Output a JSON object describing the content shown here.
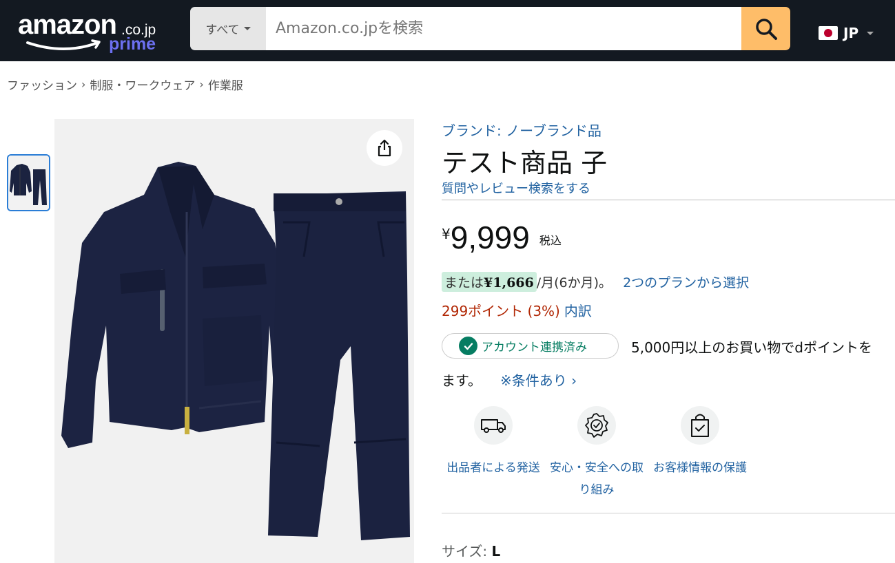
{
  "header": {
    "logo": {
      "word": "amazon",
      "suffix": ".co.jp",
      "prime": "prime"
    },
    "search": {
      "category": "すべて",
      "placeholder": "Amazon.co.jpを検索",
      "value": ""
    },
    "locale": "JP"
  },
  "breadcrumb": [
    "ファッション",
    "制服・ワークウェア",
    "作業服"
  ],
  "product": {
    "brand": "ブランド: ノーブランド品",
    "title": "テスト商品 子",
    "qa_link": "質問やレビュー検索をする",
    "price": {
      "symbol": "¥",
      "value": "9,999",
      "tax": "税込"
    },
    "installment": {
      "prefix": "または",
      "amount": "¥1,666",
      "rest": "/月(6か月)。",
      "link": "2つのプランから選択"
    },
    "points": {
      "text": "299ポイント (3%)",
      "link": "内訳"
    },
    "account": {
      "badge": "アカウント連携済み",
      "text": "5,000円以上のお買い物でdポイントを",
      "text_cont": "ます。",
      "link": "※条件あり ›"
    },
    "features": [
      {
        "icon": "delivery-truck-icon",
        "label": "出品者による発送"
      },
      {
        "icon": "safety-badge-icon",
        "label": "安心・安全への取り組み"
      },
      {
        "icon": "secure-bag-icon",
        "label": "お客様情報の保護"
      }
    ],
    "size": {
      "label": "サイズ: ",
      "value": "L"
    }
  },
  "colors": {
    "header_bg": "#131921",
    "search_button": "#febd69",
    "link": "#2162a1",
    "points": "#b12704",
    "badge_green": "#067d62",
    "installment_bg": "#cdeedd"
  }
}
